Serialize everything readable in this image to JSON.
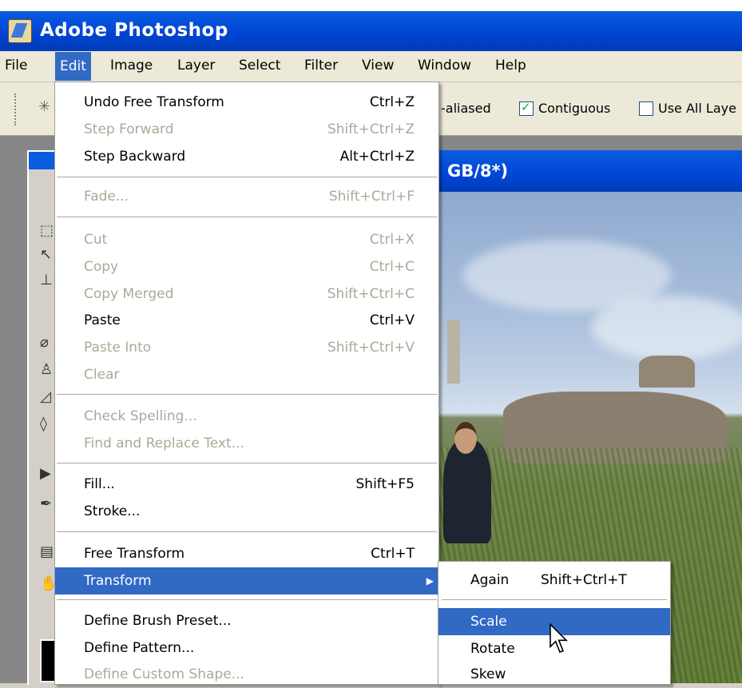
{
  "app": {
    "title": "Adobe Photoshop"
  },
  "menubar": {
    "items": [
      "File",
      "Edit",
      "Image",
      "Layer",
      "Select",
      "Filter",
      "View",
      "Window",
      "Help"
    ],
    "active": "Edit"
  },
  "options": {
    "anti_aliased_partial": "-aliased",
    "contiguous": {
      "label": "Contiguous",
      "checked": true
    },
    "use_all_layers": {
      "label": "Use All Laye",
      "checked": false
    }
  },
  "document": {
    "title_partial": "GB/8*)"
  },
  "edit_menu": {
    "items": [
      {
        "label": "Undo Free Transform",
        "shortcut": "Ctrl+Z",
        "enabled": true
      },
      {
        "label": "Step Forward",
        "shortcut": "Shift+Ctrl+Z",
        "enabled": false
      },
      {
        "label": "Step Backward",
        "shortcut": "Alt+Ctrl+Z",
        "enabled": true
      },
      {
        "label": "Fade...",
        "shortcut": "Shift+Ctrl+F",
        "enabled": false
      },
      {
        "label": "Cut",
        "shortcut": "Ctrl+X",
        "enabled": false
      },
      {
        "label": "Copy",
        "shortcut": "Ctrl+C",
        "enabled": false
      },
      {
        "label": "Copy Merged",
        "shortcut": "Shift+Ctrl+C",
        "enabled": false
      },
      {
        "label": "Paste",
        "shortcut": "Ctrl+V",
        "enabled": true
      },
      {
        "label": "Paste Into",
        "shortcut": "Shift+Ctrl+V",
        "enabled": false
      },
      {
        "label": "Clear",
        "shortcut": "",
        "enabled": false
      },
      {
        "label": "Check Spelling...",
        "shortcut": "",
        "enabled": false
      },
      {
        "label": "Find and Replace Text...",
        "shortcut": "",
        "enabled": false
      },
      {
        "label": "Fill...",
        "shortcut": "Shift+F5",
        "enabled": true
      },
      {
        "label": "Stroke...",
        "shortcut": "",
        "enabled": true
      },
      {
        "label": "Free Transform",
        "shortcut": "Ctrl+T",
        "enabled": true
      },
      {
        "label": "Transform",
        "shortcut": "",
        "enabled": true,
        "highlighted": true,
        "submenu": true
      },
      {
        "label": "Define Brush Preset...",
        "shortcut": "",
        "enabled": true
      },
      {
        "label": "Define Pattern...",
        "shortcut": "",
        "enabled": true
      },
      {
        "label": "Define Custom Shape...",
        "shortcut": "",
        "enabled": false
      }
    ]
  },
  "transform_submenu": {
    "items": [
      {
        "label": "Again",
        "shortcut": "Shift+Ctrl+T"
      },
      {
        "label": "Scale",
        "shortcut": "",
        "highlighted": true
      },
      {
        "label": "Rotate",
        "shortcut": ""
      },
      {
        "label": "Skew",
        "shortcut": ""
      }
    ]
  },
  "colors": {
    "menu_highlight": "#316ac5",
    "titlebar": "#0046d5",
    "disabled_text": "#aca899"
  }
}
